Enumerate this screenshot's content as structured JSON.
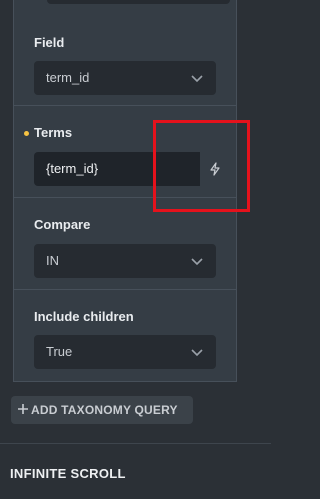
{
  "taxonomy_query": {
    "field": {
      "label": "Field",
      "value": "term_id"
    },
    "terms": {
      "label": "Terms",
      "value": "{term_id}",
      "dynamic_icon": "bolt-icon",
      "indicator_color": "#f6c343"
    },
    "compare": {
      "label": "Compare",
      "value": "IN"
    },
    "include_children": {
      "label": "Include children",
      "value": "True"
    }
  },
  "add_button": {
    "label": "ADD TAXONOMY QUERY",
    "icon": "plus-icon"
  },
  "next_section": {
    "title": "INFINITE SCROLL"
  },
  "highlight": {
    "color": "#e5121c"
  }
}
